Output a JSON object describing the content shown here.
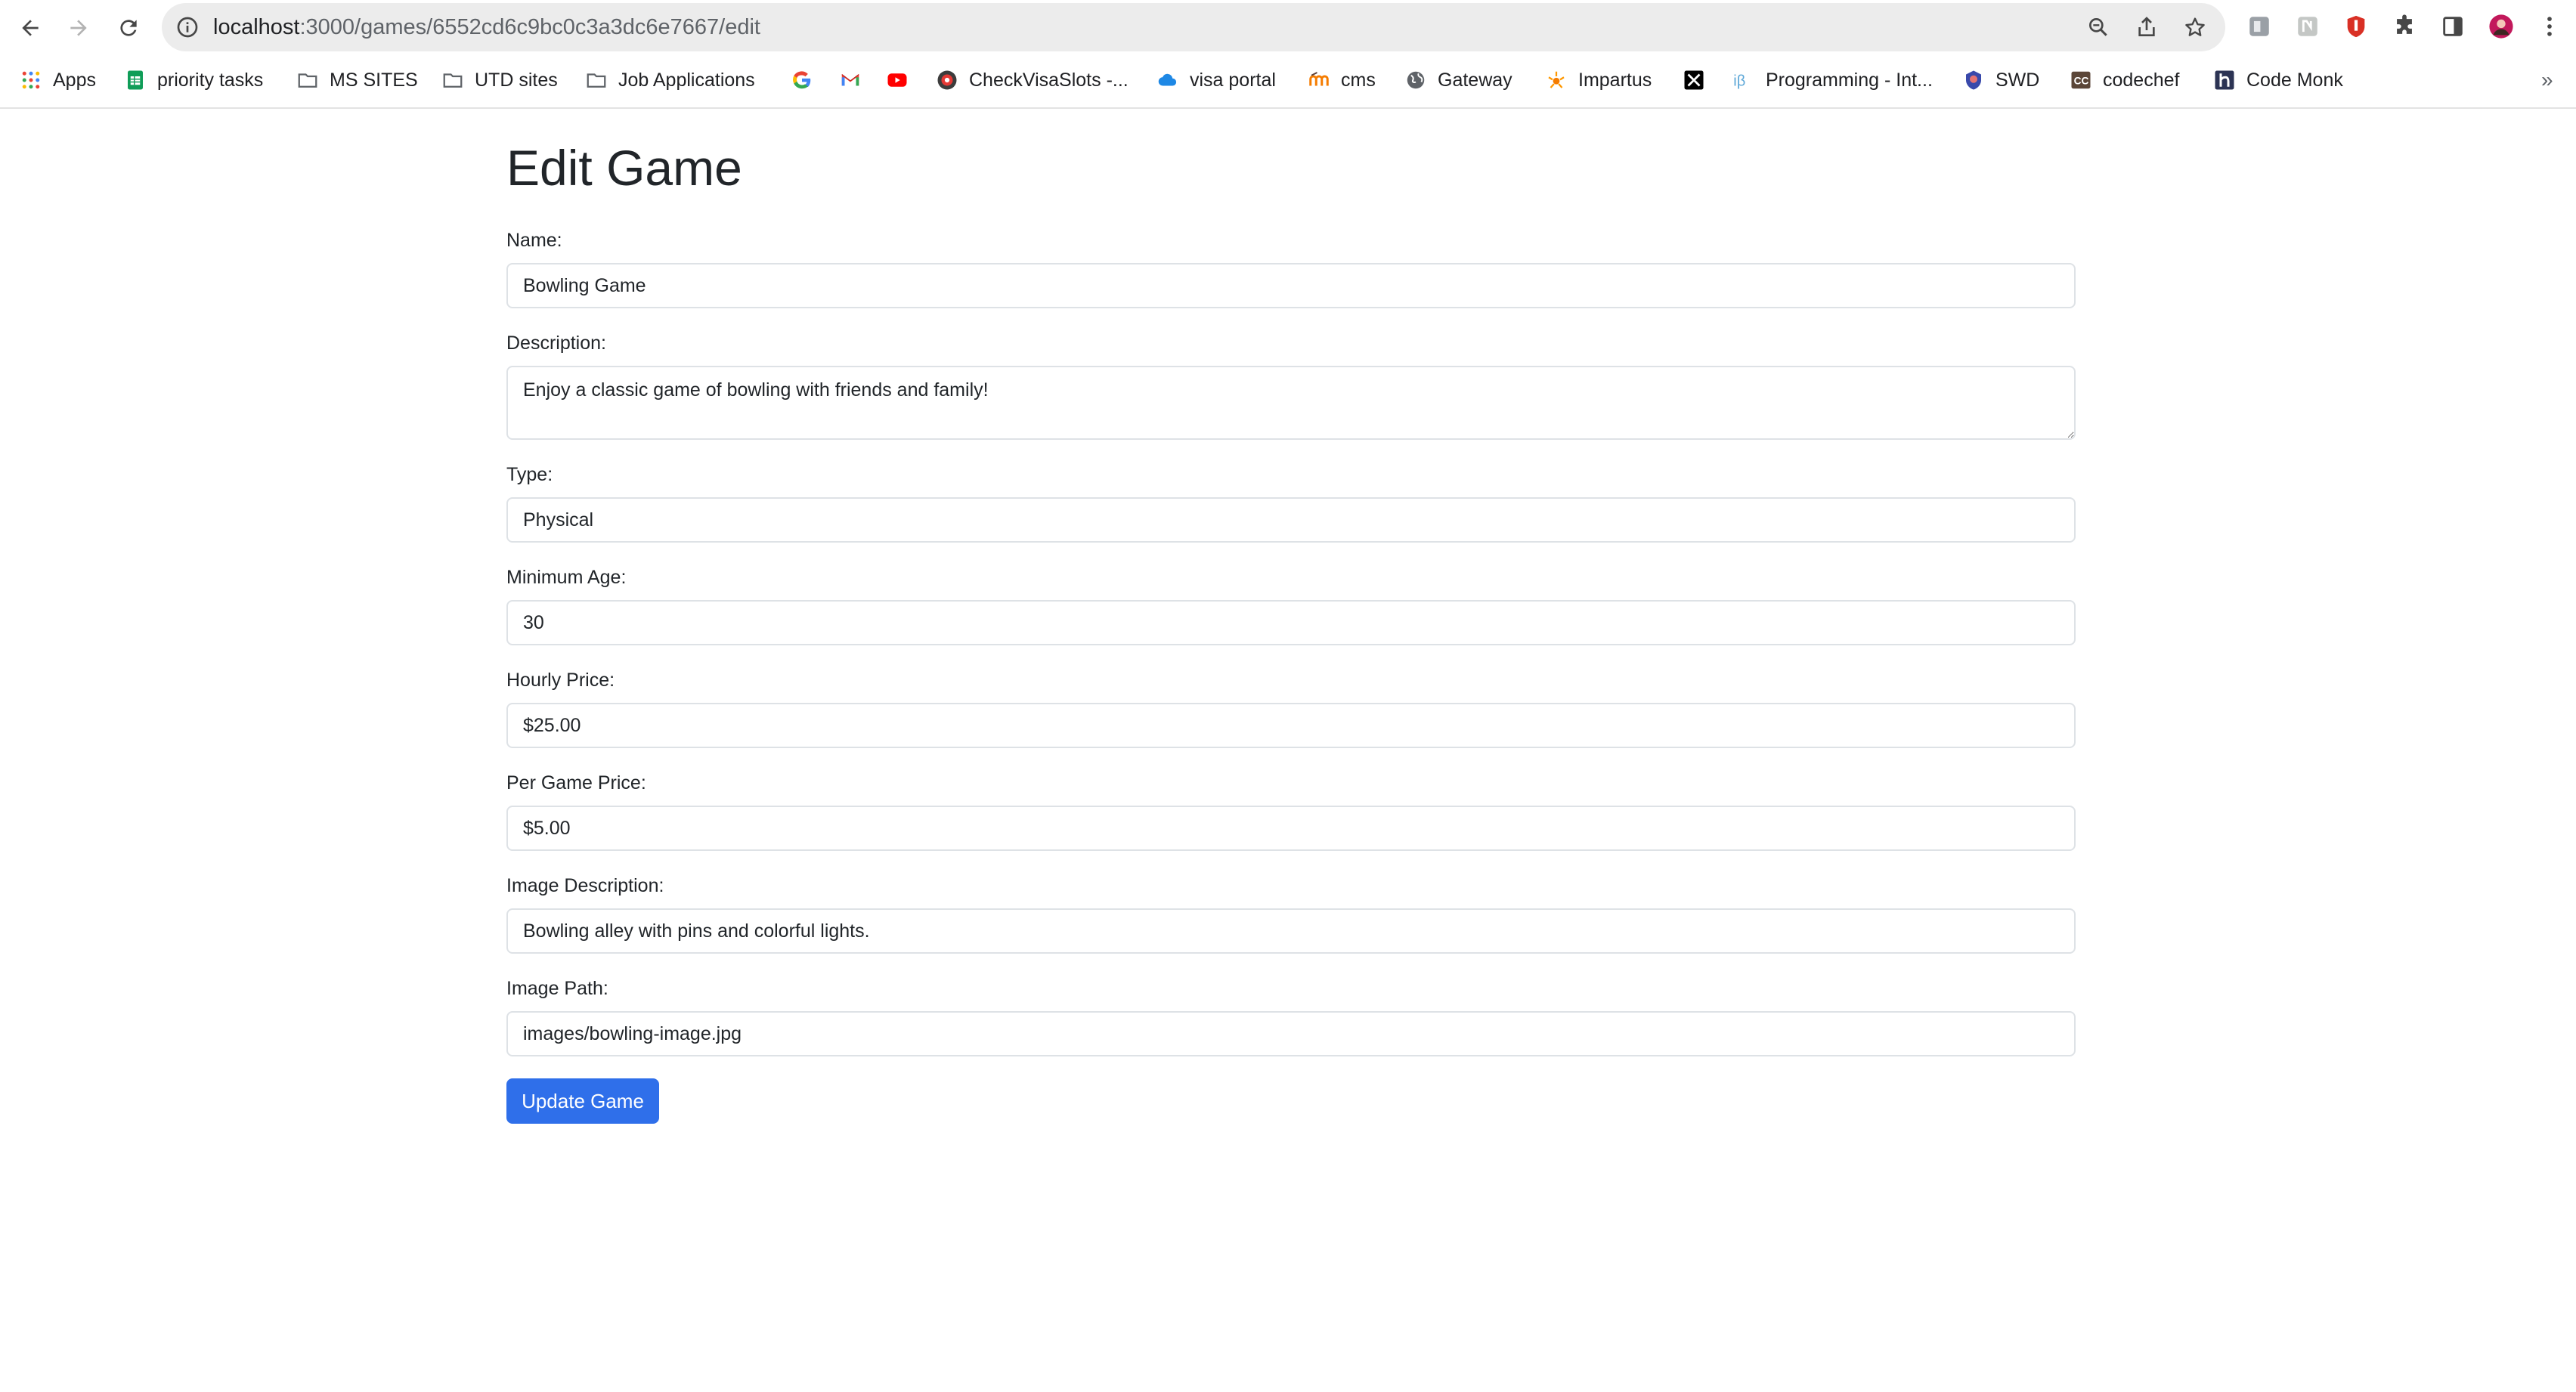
{
  "browser": {
    "url_host": "localhost",
    "url_path": ":3000/games/6552cd6c9bc0c3a3dc6e7667/edit",
    "bookmarks": [
      {
        "label": "Apps",
        "icon": "apps-grid-icon"
      },
      {
        "label": "priority tasks",
        "icon": "sheets-icon"
      },
      {
        "label": "MS SITES",
        "icon": "folder-icon"
      },
      {
        "label": "UTD sites",
        "icon": "folder-icon"
      },
      {
        "label": "Job Applications",
        "icon": "folder-icon"
      },
      {
        "label": "",
        "icon": "google-icon"
      },
      {
        "label": "",
        "icon": "gmail-icon"
      },
      {
        "label": "",
        "icon": "youtube-icon"
      },
      {
        "label": "CheckVisaSlots -...",
        "icon": "checkvisaslots-icon"
      },
      {
        "label": "visa portal",
        "icon": "cloud-icon"
      },
      {
        "label": "cms",
        "icon": "moodle-icon"
      },
      {
        "label": "Gateway",
        "icon": "globe-icon"
      },
      {
        "label": "Impartus",
        "icon": "impartus-icon"
      },
      {
        "label": "",
        "icon": "x-icon"
      },
      {
        "label": "Programming - Int...",
        "icon": "interviewbit-icon"
      },
      {
        "label": "SWD",
        "icon": "swd-icon"
      },
      {
        "label": "codechef",
        "icon": "codechef-icon"
      },
      {
        "label": "Code Monk",
        "icon": "hackerearth-icon"
      }
    ],
    "overflow_label": "»"
  },
  "page": {
    "title": "Edit Game",
    "submit_label": "Update Game"
  },
  "form": {
    "name": {
      "label": "Name:",
      "value": "Bowling Game"
    },
    "description": {
      "label": "Description:",
      "value": "Enjoy a classic game of bowling with friends and family!"
    },
    "type": {
      "label": "Type:",
      "value": "Physical"
    },
    "min_age": {
      "label": "Minimum Age:",
      "value": "30"
    },
    "hourly_price": {
      "label": "Hourly Price:",
      "value": "$25.00"
    },
    "per_game_price": {
      "label": "Per Game Price:",
      "value": "$5.00"
    },
    "image_description": {
      "label": "Image Description:",
      "value": "Bowling alley with pins and colorful lights."
    },
    "image_path": {
      "label": "Image Path:",
      "value": "images/bowling-image.jpg"
    }
  },
  "colors": {
    "primary_button": "#2f6fea",
    "input_border": "#dee2e6",
    "omnibox_bg": "#ececec"
  }
}
